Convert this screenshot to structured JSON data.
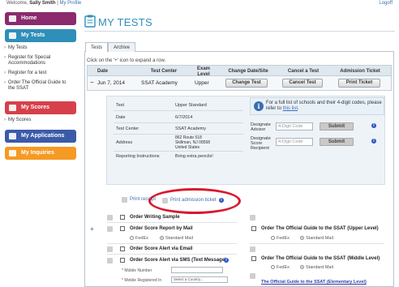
{
  "topbar": {
    "welcome": "Welcome, ",
    "user": "Sally Smith",
    "separator": " | ",
    "profile": "My Profile",
    "logoff": "Logoff"
  },
  "sidebar": {
    "home": "Home",
    "my_tests": "My Tests",
    "my_tests_items": [
      "My Tests",
      "Register for Special Accommodations",
      "Register for a test",
      "Order The Official Guide to the SSAT"
    ],
    "my_scores": "My Scores",
    "my_scores_items": [
      "My Scores"
    ],
    "my_applications": "My Applications",
    "my_inquiries": "My Inquiries",
    "colors": {
      "home": "#8b2a6d",
      "tests": "#2f8fb8",
      "scores": "#d6404b",
      "applications": "#3b5ba8",
      "inquiries": "#f59a23"
    }
  },
  "page": {
    "title": "MY TESTS"
  },
  "tabs": [
    "Tests",
    "Archive"
  ],
  "hint": "Click on the '+' icon to expand a row.",
  "table": {
    "headers": [
      "Date",
      "Test Center",
      "Exam Level",
      "Change Date/Site",
      "Cancel a Test",
      "Admission Ticket"
    ],
    "row": {
      "toggle": "−",
      "date": "Jun 7, 2014",
      "center": "SSAT Academy",
      "level": "Upper",
      "change": "Change Test",
      "cancel": "Cancel Test",
      "print": "Print Ticket"
    }
  },
  "detail": {
    "fields": [
      {
        "k": "Test",
        "v": "Upper Standard"
      },
      {
        "k": "Date",
        "v": "6/7/2014"
      },
      {
        "k": "Test Center",
        "v": "SSAT Academy"
      },
      {
        "k": "Address",
        "v": "862 Route 518\nSkillman, NJ 08558\nUnited States"
      },
      {
        "k": "Reporting Instructions",
        "v": "Bring extra pencils!"
      }
    ],
    "info": {
      "text": "For a full list of schools and their 4-digit codes, please refer to ",
      "link": "this list"
    },
    "designate_advisor": "Designate Advisor",
    "designate_recipient": "Designate Score Recipient",
    "code_placeholder": "4-Digit Code",
    "submit": "Submit",
    "print_receipt": "Print receipt",
    "print_admission": "Print admission ticket"
  },
  "orders": {
    "left": [
      {
        "label": "Order Writing Sample"
      },
      {
        "label": "Order Score Report by Mail"
      },
      {
        "label": "Order Score Alert via Email"
      },
      {
        "label": "Order Score Alert via SMS (Text Message)"
      }
    ],
    "shipping": {
      "fedex": "FedEx",
      "standard": "Standard Mail"
    },
    "mobile_number": "Mobile Number",
    "mobile_registered": "Mobile Registered In",
    "country_placeholder": "Select a Country...",
    "right": [
      {
        "label": "Order The Official Guide to the SSAT (Upper Level)"
      },
      {
        "label": "Order The Official Guide to the SSAT (Middle Level)"
      }
    ],
    "elementary_link": "The Official Guide to the SSAT (Elementary Level)"
  }
}
